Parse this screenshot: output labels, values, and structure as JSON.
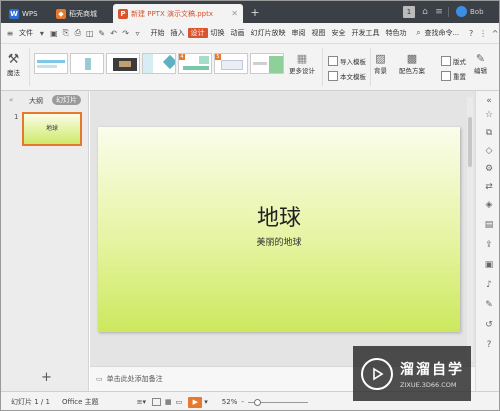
{
  "titlebar": {
    "tabs": [
      {
        "label": "WPS",
        "icon": "wps-logo-icon"
      },
      {
        "label": "稻壳商城",
        "icon": "docer-icon"
      },
      {
        "label": "新建 PPTX 演示文稿.pptx",
        "icon": "presentation-icon"
      }
    ],
    "new_tab": "+",
    "badge": "1",
    "user": "Bob"
  },
  "menubar": {
    "file": "文件",
    "items": [
      "开始",
      "插入",
      "设计",
      "切换",
      "动画",
      "幻灯片放映",
      "审阅",
      "视图",
      "安全",
      "开发工具",
      "特色功"
    ],
    "active": "设计",
    "search": "查找命令..."
  },
  "ribbon": {
    "magic": "魔法",
    "more_design": "更多设计",
    "import_template": "导入模板",
    "text_template": "本文模板",
    "background": "背景",
    "color_scheme": "配色方案",
    "layout": "版式",
    "reset": "重置",
    "edit": "编辑",
    "thumb_numbers": [
      "",
      "",
      "",
      "",
      "4",
      "5"
    ]
  },
  "leftpanel": {
    "tabs": [
      "大纲",
      "幻灯片"
    ],
    "active_tab": "幻灯片",
    "slide_number": "1",
    "thumb_text": "地球",
    "add_button": "+"
  },
  "slide": {
    "title": "地球",
    "subtitle": "美丽的地球"
  },
  "notes": {
    "placeholder": "单击此处添加备注"
  },
  "statusbar": {
    "slide_info": "幻灯片 1 / 1",
    "theme": "Office 主题",
    "zoom": "52%"
  },
  "watermark": {
    "name": "溜溜自学",
    "url": "ZIXUE.3D66.COM"
  },
  "colors": {
    "accent": "#d9532c",
    "titlebar": "#3b4046",
    "slide_top": "#fafdec",
    "slide_bottom": "#cce85e"
  }
}
